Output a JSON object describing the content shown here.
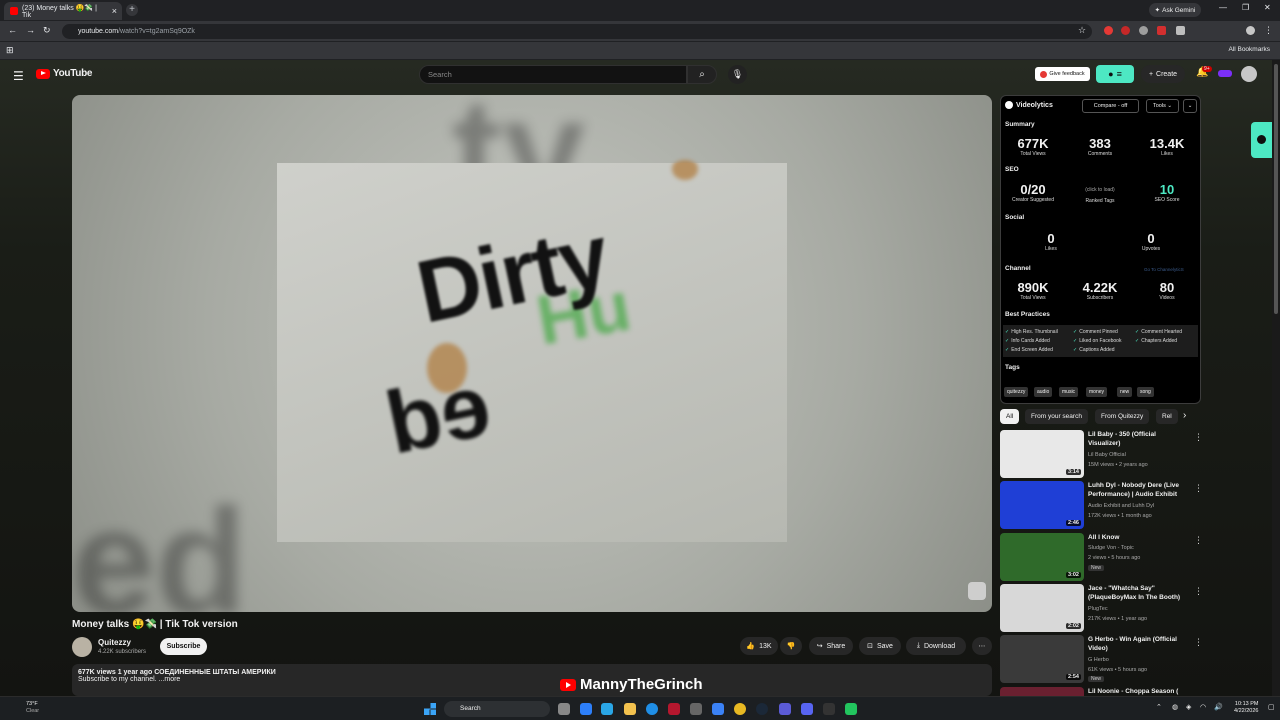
{
  "browser": {
    "tab_title": "(23) Money talks 🤑💸 | Tik",
    "ask_gemini": "Ask Gemini",
    "url_host": "youtube.com",
    "url_path": "/watch?v=tg2amSq9OZk",
    "all_bookmarks": "All Bookmarks"
  },
  "youtube": {
    "logo_text": "YouTube",
    "search_placeholder": "Search",
    "give_feedback": "Give feedback",
    "create_label": "Create",
    "notifications_badge": "9+"
  },
  "video": {
    "title": "Money talks 🤑💸 | Tik Tok version",
    "channel_name": "Quitezzy",
    "channel_subs": "4.22K subscribers",
    "subscribe_label": "Subscribe",
    "likes": "13K",
    "share_label": "Share",
    "save_label": "Save",
    "download_label": "Download",
    "desc_meta": "677K views  1 year ago  СОЕДИНЕННЫЕ ШТАТЫ АМЕРИКИ",
    "desc_text": "Subscribe to my channel. ...more",
    "frame_text_main": "Dirty",
    "frame_text_secondary": "ed",
    "watermark": "MannyTheGrinch"
  },
  "videolytics": {
    "name": "Videolytics",
    "compare_label": "Compare - off",
    "tools_label": "Tools",
    "summary_title": "Summary",
    "summary": [
      {
        "value": "677K",
        "label": "Total Views"
      },
      {
        "value": "383",
        "label": "Comments"
      },
      {
        "value": "13.4K",
        "label": "Likes"
      }
    ],
    "seo_title": "SEO",
    "seo": [
      {
        "value": "0/20",
        "label": "Creator Suggested"
      },
      {
        "value": "(click to load)",
        "label": "Ranked Tags"
      },
      {
        "value": "10",
        "label": "SEO Score"
      }
    ],
    "social_title": "Social",
    "social": [
      {
        "value": "0",
        "label": "Likes"
      },
      {
        "value": "0",
        "label": "Upvotes"
      }
    ],
    "channel_title": "Channel",
    "channel_link": "Go To ChannelyticS",
    "channel": [
      {
        "value": "890K",
        "label": "Total Views"
      },
      {
        "value": "4.22K",
        "label": "Subscribers"
      },
      {
        "value": "80",
        "label": "Videos"
      }
    ],
    "bp_title": "Best Practices",
    "best_practices": [
      "High Res. Thumbnail",
      "Comment Pinned",
      "Comment Hearted",
      "Info Cards Added",
      "Liked on Facebook",
      "Chapters Added",
      "End Screen Added",
      "Captions Added"
    ],
    "tags_title": "Tags",
    "tags": [
      "quitezzy",
      "audio",
      "music",
      "money",
      "new",
      "song"
    ]
  },
  "chips": [
    "All",
    "From your search",
    "From Quitezzy",
    "Rel"
  ],
  "recommendations": [
    {
      "title": "Lil Baby - 350 (Official Visualizer)",
      "channel": "Lil Baby Official",
      "meta": "15M views • 2 years ago",
      "duration": "3:14",
      "new": "",
      "color": "#e8e8e8"
    },
    {
      "title": "Luhh Dyl - Nobody Dere (Live Performance) | Audio Exhibit",
      "channel": "Audio Exhibit and Luhh Dyl",
      "meta": "172K views • 1 month ago",
      "duration": "2:46",
      "new": "",
      "color": "#1f3fd6"
    },
    {
      "title": "All I Know",
      "channel": "Sludge Von - Topic",
      "meta": "2 views • 5 hours ago",
      "duration": "3:02",
      "new": "New",
      "color": "#2f6a2a"
    },
    {
      "title": "Jace - \"Whatcha Say\" (PlaqueBoyMax In The Booth)",
      "channel": "PlugTec",
      "meta": "217K views • 1 year ago",
      "duration": "2:02",
      "new": "",
      "color": "#d8d8d8"
    },
    {
      "title": "G Herbo - Win Again (Official Video)",
      "channel": "G Herbo",
      "meta": "61K views • 5 hours ago",
      "duration": "2:54",
      "new": "New",
      "color": "#3a3a3a"
    },
    {
      "title": "Lil Noonie - Choppa Season (",
      "channel": "",
      "meta": "",
      "duration": "",
      "new": "",
      "color": "#6a2030"
    }
  ],
  "taskbar": {
    "temp": "73°F",
    "weather": "Clear",
    "search": "Search",
    "time": "10:13 PM",
    "date": "4/22/2026"
  }
}
